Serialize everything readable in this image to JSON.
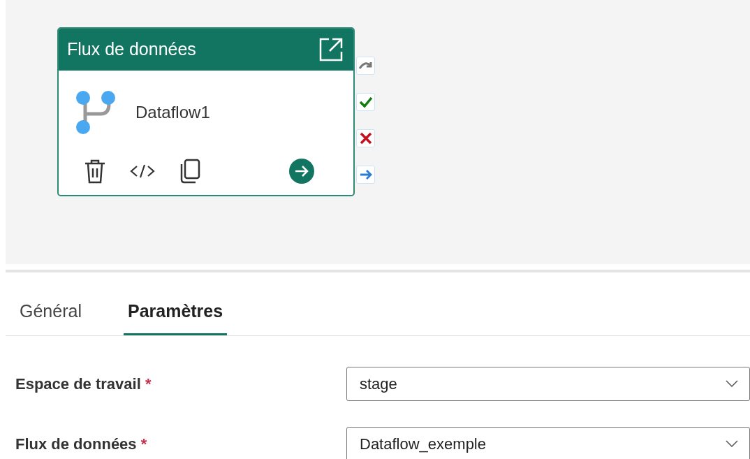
{
  "activity": {
    "header_title": "Flux de données",
    "name": "Dataflow1"
  },
  "tabs": [
    {
      "label": "Général",
      "selected": false
    },
    {
      "label": "Paramètres",
      "selected": true
    }
  ],
  "fields": [
    {
      "label": "Espace de travail",
      "required_mark": "*",
      "value": "stage"
    },
    {
      "label": "Flux de données",
      "required_mark": "*",
      "value": "Dataflow_exemple"
    }
  ]
}
